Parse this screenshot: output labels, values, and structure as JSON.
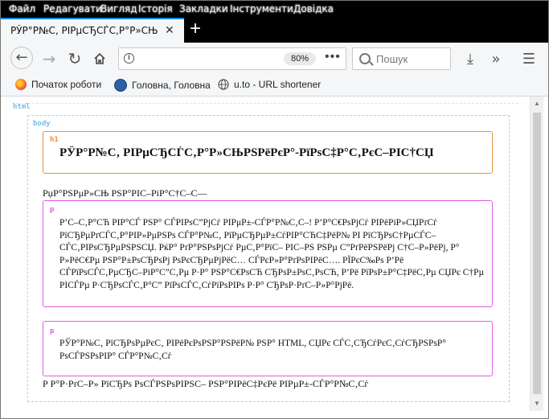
{
  "menubar": {
    "items": [
      "Файл",
      "Редагувати",
      "Вигляд",
      "Історія",
      "Закладки",
      "Інструменти",
      "Довідка"
    ]
  },
  "tab": {
    "title": "РЎР°Р№С‚ РІРμСЂСЃС‚Р°Р»СЊРЅ"
  },
  "navbar": {
    "zoom": "80%",
    "search_placeholder": "Пошук"
  },
  "bookmarks": [
    {
      "label": "Початок роботи",
      "icon": "firefox-icon"
    },
    {
      "label": "Головна, Головна",
      "icon": "ua-site-icon"
    },
    {
      "label": "u.to - URL shortener",
      "icon": "globe-icon"
    }
  ],
  "page": {
    "html_label": "html",
    "body_label": "body",
    "h1_label": "h1",
    "h1_text": "РЎР°Р№С‚ РІРμСЂСЃС‚Р°Р»СЊРЅРёРєР°-РїРѕС‡Р°С‚РєС–РІС†СЏ",
    "line1": "РџР°РЅРμР»СЊ РЅР°РІС–РіР°С†С–С—",
    "p1_label": "p",
    "p1_text": "Р’С–С‚Р°СЋ РІР°СЃ РЅР° СЃРІРѕС”РјСѓ РІРμР±-СЃР°Р№С‚С–! Р’Р°С€РѕРјСѓ РІРёРіР»СЏРґСѓ РїСЂРμРґСЃС‚Р°РІР»РμРЅРѕ СЃР°Р№С‚ РїРµСЂРµР±СѓРІР°СЋС‡РёР№ РІ РїСЂРѕС†РµСЃС– СЃС‚РІРѕСЂРµРЅРЅСЏ. РќР° РґР°РЅРѕРјСѓ РµС‚Р°РїС– РІС–РЅ РЅРµ С”РґРёРЅРёРј С†С–Р»РёРј, Р° Р»РёС€Рµ РЅР°Р±РѕСЂРѕРј РѕРєСЂРµРјРёС… СЃРєР»Р°РґРѕРІРёС…. РЇРєС‰Рѕ Р’Рё СЃРїРѕСЃС‚РµСЂС–РіР°С”С‚Рµ Р·Р° РЅР°С€РѕСЋ СЂРѕР±РѕС‚РѕСЋ, Р’Рё РїРѕР±Р°С‡РёС‚Рµ СЏРє С†Рµ РІСЃРµ Р·СЂРѕСЃС‚Р°С” РїРѕСЃС‚СѓРїРѕРІРѕ Р·Р° СЂРѕР·РґС–Р»Р°РјРё.",
    "p2_label": "p",
    "p2_text": "РЎР°Р№С‚ РїСЂРѕРµРєС‚ РІРёРєРѕРЅР°РЅРёР№ РЅР° HTML, СЏРє СЃС‚СЂСѓРєС‚СѓСЂРЅРѕР° РѕСЃРЅРѕРІР° СЃР°Р№С‚Сѓ",
    "line2": "Р Р°Р·РґС–Р» РїСЂРѕ РѕСЃРЅРѕРІРЅС– РЅР°РІРёС‡РєРё РІРµР±-СЃР°Р№С‚Сѓ"
  },
  "colors": {
    "h1_border": "#e8913a",
    "p_border": "#e05ce8",
    "dashed_border": "#a9d3f5",
    "label_blue": "#7bbce8",
    "label_h1": "#e8913a",
    "label_p": "#e05ce8"
  }
}
